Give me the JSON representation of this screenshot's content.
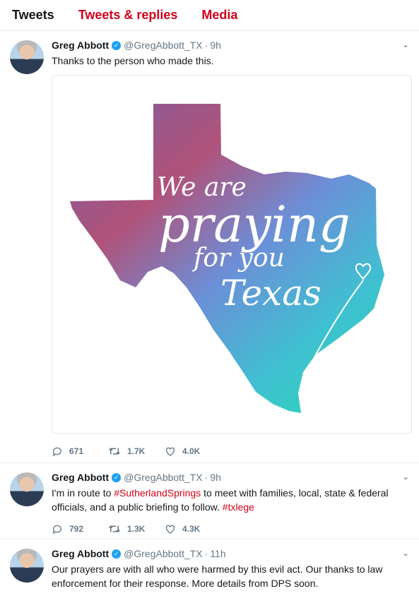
{
  "tabs": [
    "Tweets",
    "Tweets & replies",
    "Media"
  ],
  "tweets": [
    {
      "name": "Greg Abbott",
      "handle": "@GregAbbott_TX",
      "dot": "·",
      "time": "9h",
      "text": "Thanks to the person who made this.",
      "media": {
        "line1": "We are",
        "line2": "praying",
        "line3": "for you",
        "line4": "Texas"
      },
      "replies": "671",
      "retweets": "1.7K",
      "likes": "4.0K"
    },
    {
      "name": "Greg Abbott",
      "handle": "@GregAbbott_TX",
      "dot": "·",
      "time": "9h",
      "text_before": "I'm in route to ",
      "hashtag1": "#SutherlandSprings",
      "text_mid": " to meet with families, local, state & federal officials, and a public briefing to follow. ",
      "hashtag2": "#txlege",
      "replies": "792",
      "retweets": "1.3K",
      "likes": "4.3K"
    },
    {
      "name": "Greg Abbott",
      "handle": "@GregAbbott_TX",
      "dot": "·",
      "time": "11h",
      "text": "Our prayers are with all who were harmed by this evil act. Our thanks to law enforcement for their response. More details from DPS soon."
    }
  ],
  "icons": {
    "verified": "verified-badge-icon",
    "caret": "chevron-down-icon",
    "reply": "reply-icon",
    "retweet": "retweet-icon",
    "like": "heart-icon"
  },
  "colors": {
    "hashtag": "#d0021b",
    "tab_red": "#d0021b",
    "verified": "#1da1f2"
  }
}
